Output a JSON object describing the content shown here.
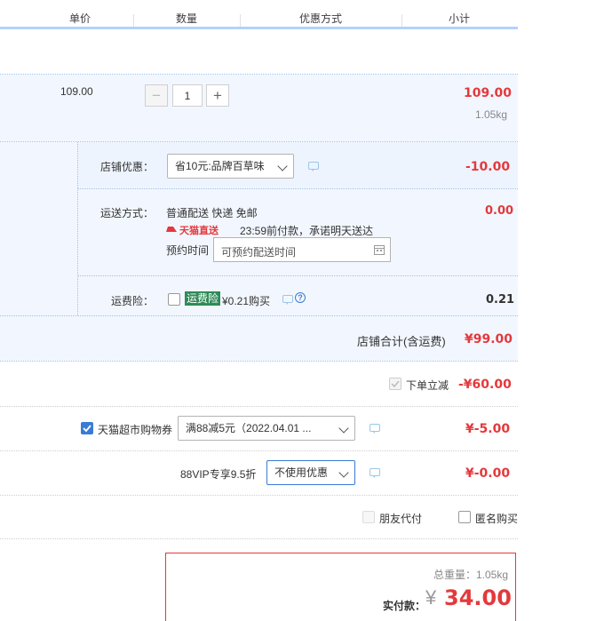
{
  "header": {
    "col_price": "单价",
    "col_qty": "数量",
    "col_promo": "优惠方式",
    "col_subtotal": "小计"
  },
  "item": {
    "unit_price": "109.00",
    "quantity": "1",
    "minus": "−",
    "plus": "+",
    "subtotal": "109.00",
    "weight": "1.05kg"
  },
  "shop": {
    "discount_label": "店铺优惠：",
    "discount_select": "省10元:品牌百草味",
    "discount_amount": "-10.00",
    "shipping_label": "运送方式：",
    "shipping_text": "普通配送 快递 免邮",
    "shipping_amount": "0.00",
    "direct_badge": "天猫直送",
    "direct_text": "23:59前付款，承诺明天送达",
    "reserve_label": "预约时间",
    "reserve_placeholder": "可预约配送时间",
    "insurance_label": "运费险：",
    "insurance_tag": "运费险",
    "insurance_text": "¥0.21购买",
    "insurance_amount": "0.21",
    "total_label": "店铺合计(含运费)",
    "total_amount": "¥99.00"
  },
  "order": {
    "instant_label": "下单立减",
    "instant_amount": "-¥60.00",
    "coupon_label": "天猫超市购物券",
    "coupon_select": "满88减5元（2022.04.01 ...",
    "coupon_amount": "¥-5.00",
    "vip_label": "88VIP专享9.5折",
    "vip_select": "不使用优惠",
    "vip_amount": "¥-0.00",
    "friend_pay": "朋友代付",
    "anonymous": "匿名购买"
  },
  "summary": {
    "weight_label": "总重量：",
    "weight_value": "1.05kg",
    "pay_label": "实付款：",
    "currency": "¥",
    "pay_amount": "34.00"
  },
  "colors": {
    "accent_red": "#e4393c",
    "header_border": "#b2d1ff",
    "panel_bg": "#f2f7ff",
    "checkbox_blue": "#3a7bd5"
  }
}
